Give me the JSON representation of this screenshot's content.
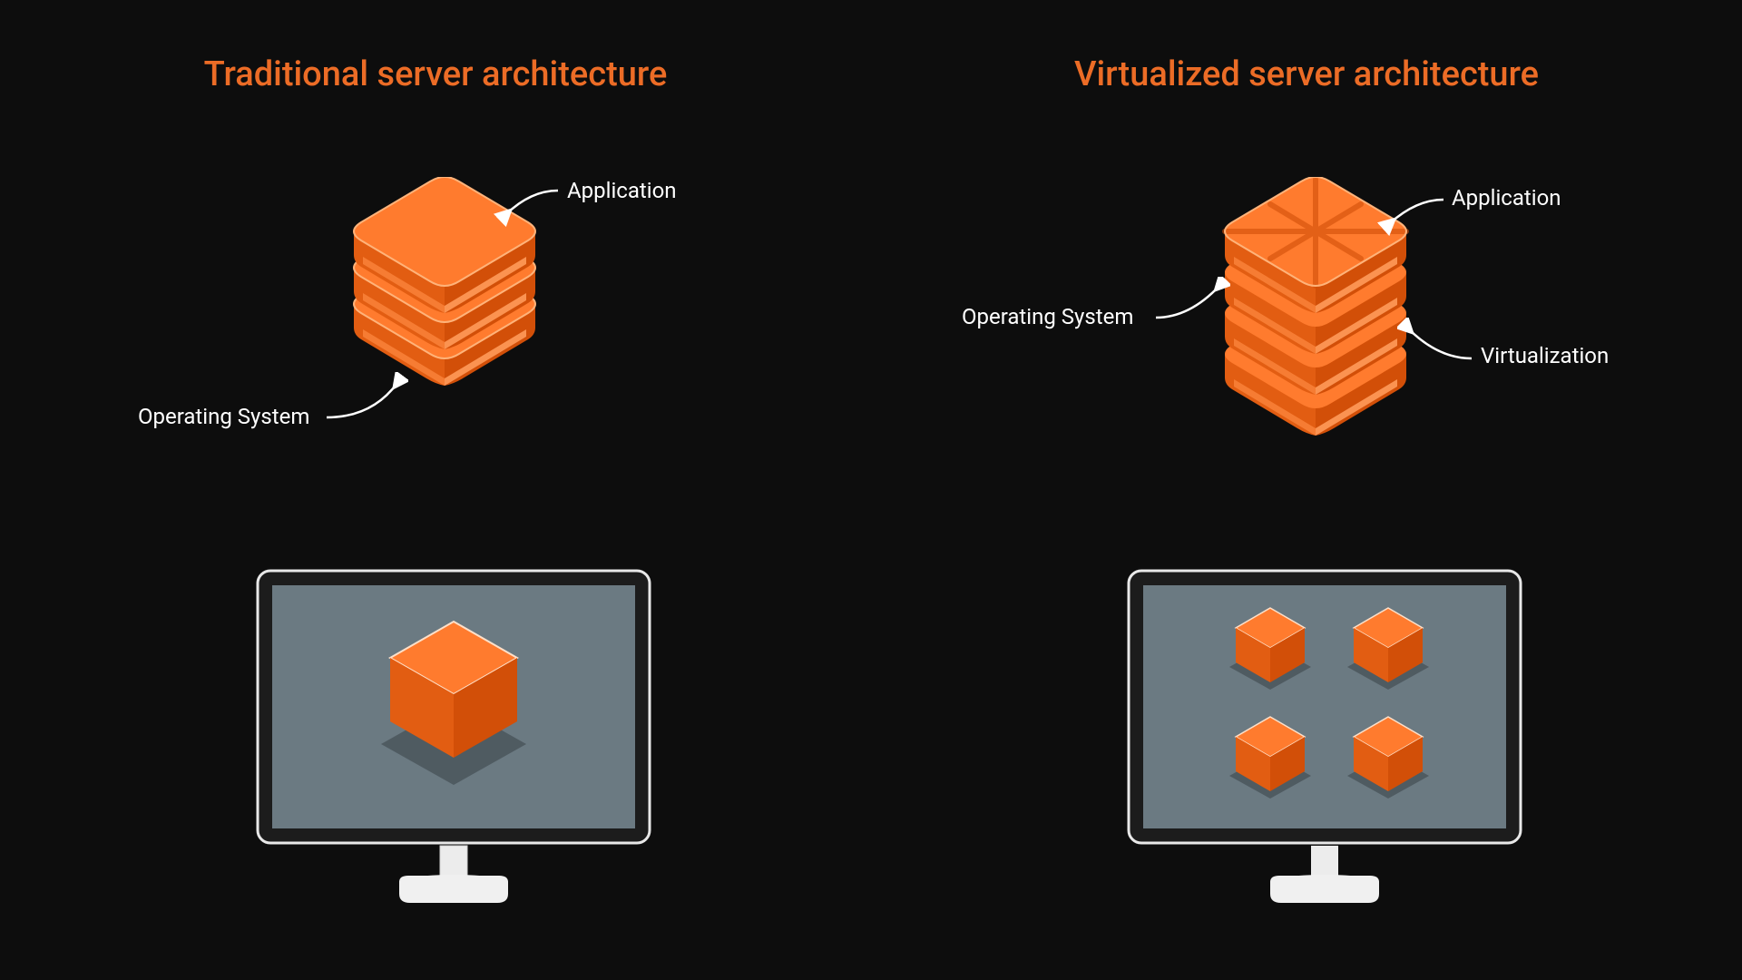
{
  "left": {
    "title": "Traditional server architecture",
    "labels": {
      "application": "Application",
      "os": "Operating System"
    }
  },
  "right": {
    "title": "Virtualized server architecture",
    "labels": {
      "application": "Application",
      "os": "Operating System",
      "virtualization": "Virtualization"
    }
  },
  "colors": {
    "accent": "#ec6c26",
    "text": "#ffffff",
    "bg": "#0d0d0d"
  }
}
